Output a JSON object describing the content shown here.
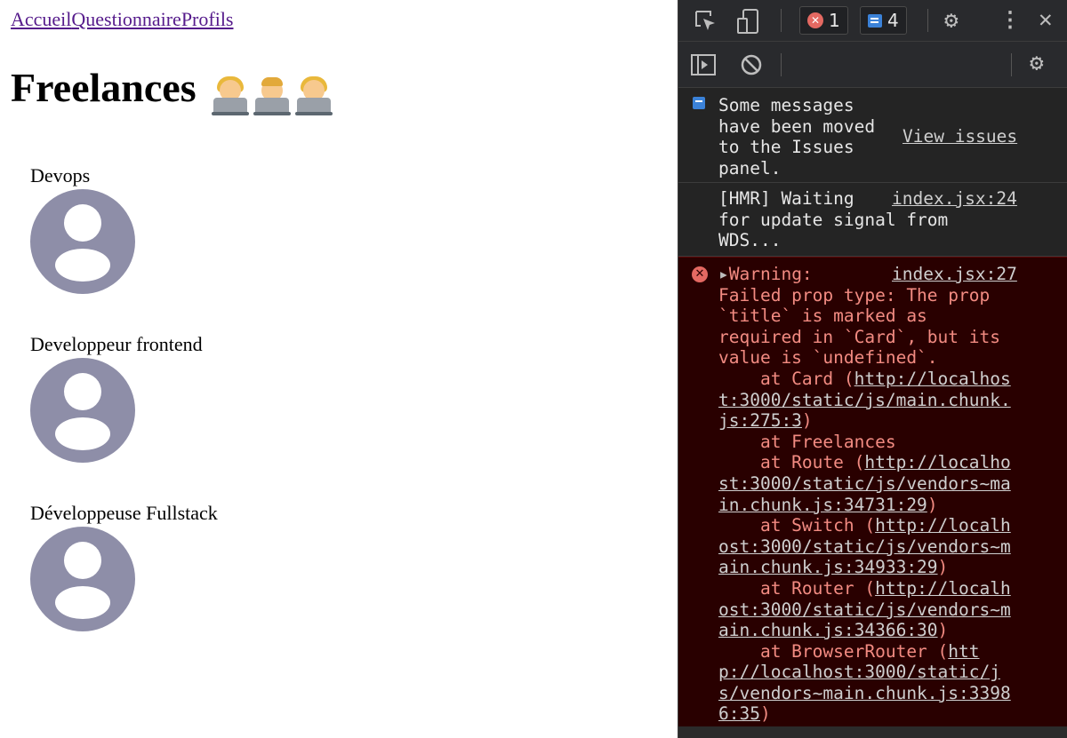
{
  "nav": {
    "home": "Accueil",
    "survey": "Questionnaire",
    "profiles": "Profils"
  },
  "page": {
    "title": "Freelances",
    "cards": [
      {
        "title": "Devops"
      },
      {
        "title": "Developpeur frontend"
      },
      {
        "title": "Développeuse Fullstack"
      }
    ]
  },
  "devtools": {
    "error_count": "1",
    "message_count": "4",
    "context": "top",
    "messages": {
      "info": {
        "text": "Some messages\nhave been moved\nto the Issues\npanel.",
        "link": "View issues"
      },
      "hmr": {
        "text": "[HMR] Waiting\nfor update signal from\nWDS...",
        "source": "index.jsx:24"
      },
      "warning": {
        "head": "Warning:",
        "source": "index.jsx:27",
        "body": "Failed prop type: The prop\n`title` is marked as\nrequired in `Card`, but its\nvalue is `undefined`.",
        "stack": [
          {
            "prefix": "    at Card (",
            "url": "http://localhos\nt:3000/static/js/main.chunk.\njs:275:3",
            "suffix": ")"
          },
          {
            "prefix": "    at Freelances",
            "url": "",
            "suffix": ""
          },
          {
            "prefix": "    at Route (",
            "url": "http://localho\nst:3000/static/js/vendors~ma\nin.chunk.js:34731:29",
            "suffix": ")"
          },
          {
            "prefix": "    at Switch (",
            "url": "http://localh\nost:3000/static/js/vendors~m\nain.chunk.js:34933:29",
            "suffix": ")"
          },
          {
            "prefix": "    at Router (",
            "url": "http://localh\nost:3000/static/js/vendors~m\nain.chunk.js:34366:30",
            "suffix": ")"
          },
          {
            "prefix": "    at BrowserRouter (",
            "url": "htt\np://localhost:3000/static/j\ns/vendors~main.chunk.js:3398\n6:35",
            "suffix": ")"
          }
        ]
      }
    }
  }
}
